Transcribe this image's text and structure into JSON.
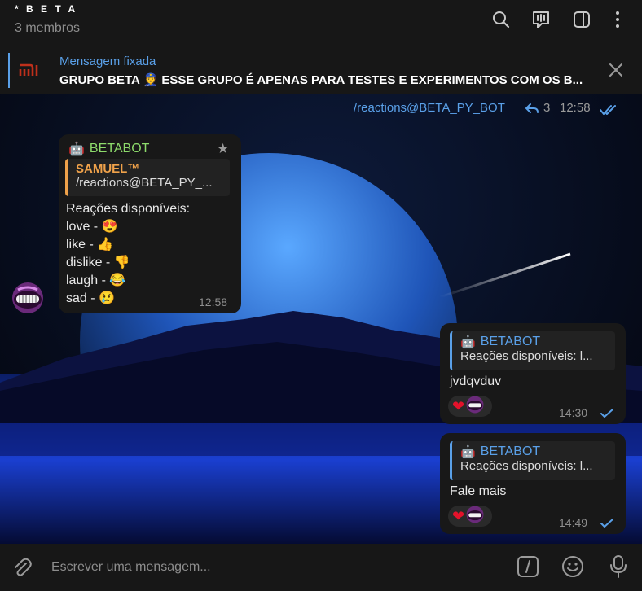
{
  "header": {
    "title": "* B E T A",
    "subtitle": "3 membros"
  },
  "pinned": {
    "label": "Mensagem fixada",
    "text": "GRUPO BETA  👮 ESSE GRUPO É APENAS PARA TESTES E EXPERIMENTOS COM OS B..."
  },
  "top_message": {
    "text": "/reactions@BETA_PY_BOT",
    "reply_count": "3",
    "time": "12:58"
  },
  "bot_message": {
    "sender": "BETABOT",
    "reply_to_name": "SAMUEL™",
    "reply_to_text": "/reactions@BETA_PY_...",
    "lines": [
      "Reações disponíveis:",
      "love - 😍",
      "like - 👍",
      "dislike - 👎",
      "laugh - 😂",
      "sad - 😢"
    ],
    "time": "12:58"
  },
  "out_messages": [
    {
      "reply_name": "BETABOT",
      "reply_text": "Reações disponíveis: l...",
      "text": "jvdqvduv",
      "time": "14:30"
    },
    {
      "reply_name": "BETABOT",
      "reply_text": "Reações disponíveis: l...",
      "text": "Fale mais",
      "time": "14:49"
    }
  ],
  "input": {
    "placeholder": "Escrever uma mensagem..."
  },
  "colors": {
    "accent": "#5aa0e8",
    "bot_name": "#8ddb6b",
    "reply_name": "#f0a24a",
    "bubble": "#181818",
    "bar": "#171717"
  }
}
